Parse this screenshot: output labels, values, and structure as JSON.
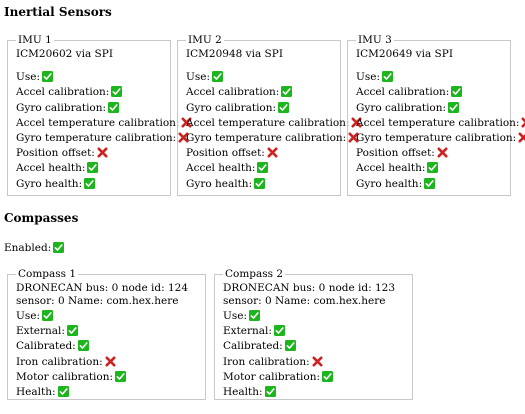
{
  "inertial": {
    "heading": "Inertial Sensors",
    "imus": [
      {
        "legend": "IMU 1",
        "device": "ICM20602 via SPI",
        "checks": [
          {
            "label": "Use:",
            "ok": true
          },
          {
            "label": "Accel calibration:",
            "ok": true
          },
          {
            "label": "Gyro calibration:",
            "ok": true
          },
          {
            "label": "Accel temperature calibration:",
            "ok": false
          },
          {
            "label": "Gyro temperature calibration:",
            "ok": false
          },
          {
            "label": "Position offset:",
            "ok": false
          },
          {
            "label": "Accel health:",
            "ok": true
          },
          {
            "label": "Gyro health:",
            "ok": true
          }
        ]
      },
      {
        "legend": "IMU 2",
        "device": "ICM20948 via SPI",
        "checks": [
          {
            "label": "Use:",
            "ok": true
          },
          {
            "label": "Accel calibration:",
            "ok": true
          },
          {
            "label": "Gyro calibration:",
            "ok": true
          },
          {
            "label": "Accel temperature calibration:",
            "ok": false
          },
          {
            "label": "Gyro temperature calibration:",
            "ok": false
          },
          {
            "label": "Position offset:",
            "ok": false
          },
          {
            "label": "Accel health:",
            "ok": true
          },
          {
            "label": "Gyro health:",
            "ok": true
          }
        ]
      },
      {
        "legend": "IMU 3",
        "device": "ICM20649 via SPI",
        "checks": [
          {
            "label": "Use:",
            "ok": true
          },
          {
            "label": "Accel calibration:",
            "ok": true
          },
          {
            "label": "Gyro calibration:",
            "ok": true
          },
          {
            "label": "Accel temperature calibration:",
            "ok": false
          },
          {
            "label": "Gyro temperature calibration:",
            "ok": false
          },
          {
            "label": "Position offset:",
            "ok": false
          },
          {
            "label": "Accel health:",
            "ok": true
          },
          {
            "label": "Gyro health:",
            "ok": true
          }
        ]
      }
    ]
  },
  "compasses": {
    "heading": "Compasses",
    "enabled_label": "Enabled:",
    "enabled_ok": true,
    "items": [
      {
        "legend": "Compass 1",
        "description": "DRONECAN bus: 0 node id: 124 sensor: 0 Name: com.hex.here",
        "checks": [
          {
            "label": "Use:",
            "ok": true
          },
          {
            "label": "External:",
            "ok": true
          },
          {
            "label": "Calibrated:",
            "ok": true
          },
          {
            "label": "Iron calibration:",
            "ok": false
          },
          {
            "label": "Motor calibration:",
            "ok": true
          },
          {
            "label": "Health:",
            "ok": true
          }
        ]
      },
      {
        "legend": "Compass 2",
        "description": "DRONECAN bus: 0 node id: 123 sensor: 0 Name: com.hex.here",
        "checks": [
          {
            "label": "Use:",
            "ok": true
          },
          {
            "label": "External:",
            "ok": true
          },
          {
            "label": "Calibrated:",
            "ok": true
          },
          {
            "label": "Iron calibration:",
            "ok": false
          },
          {
            "label": "Motor calibration:",
            "ok": true
          },
          {
            "label": "Health:",
            "ok": true
          }
        ]
      }
    ]
  },
  "icons": {
    "ok": "check-mark-icon",
    "fail": "cross-mark-icon",
    "ok_color": "#1db51d",
    "fail_color": "#cc2222"
  }
}
